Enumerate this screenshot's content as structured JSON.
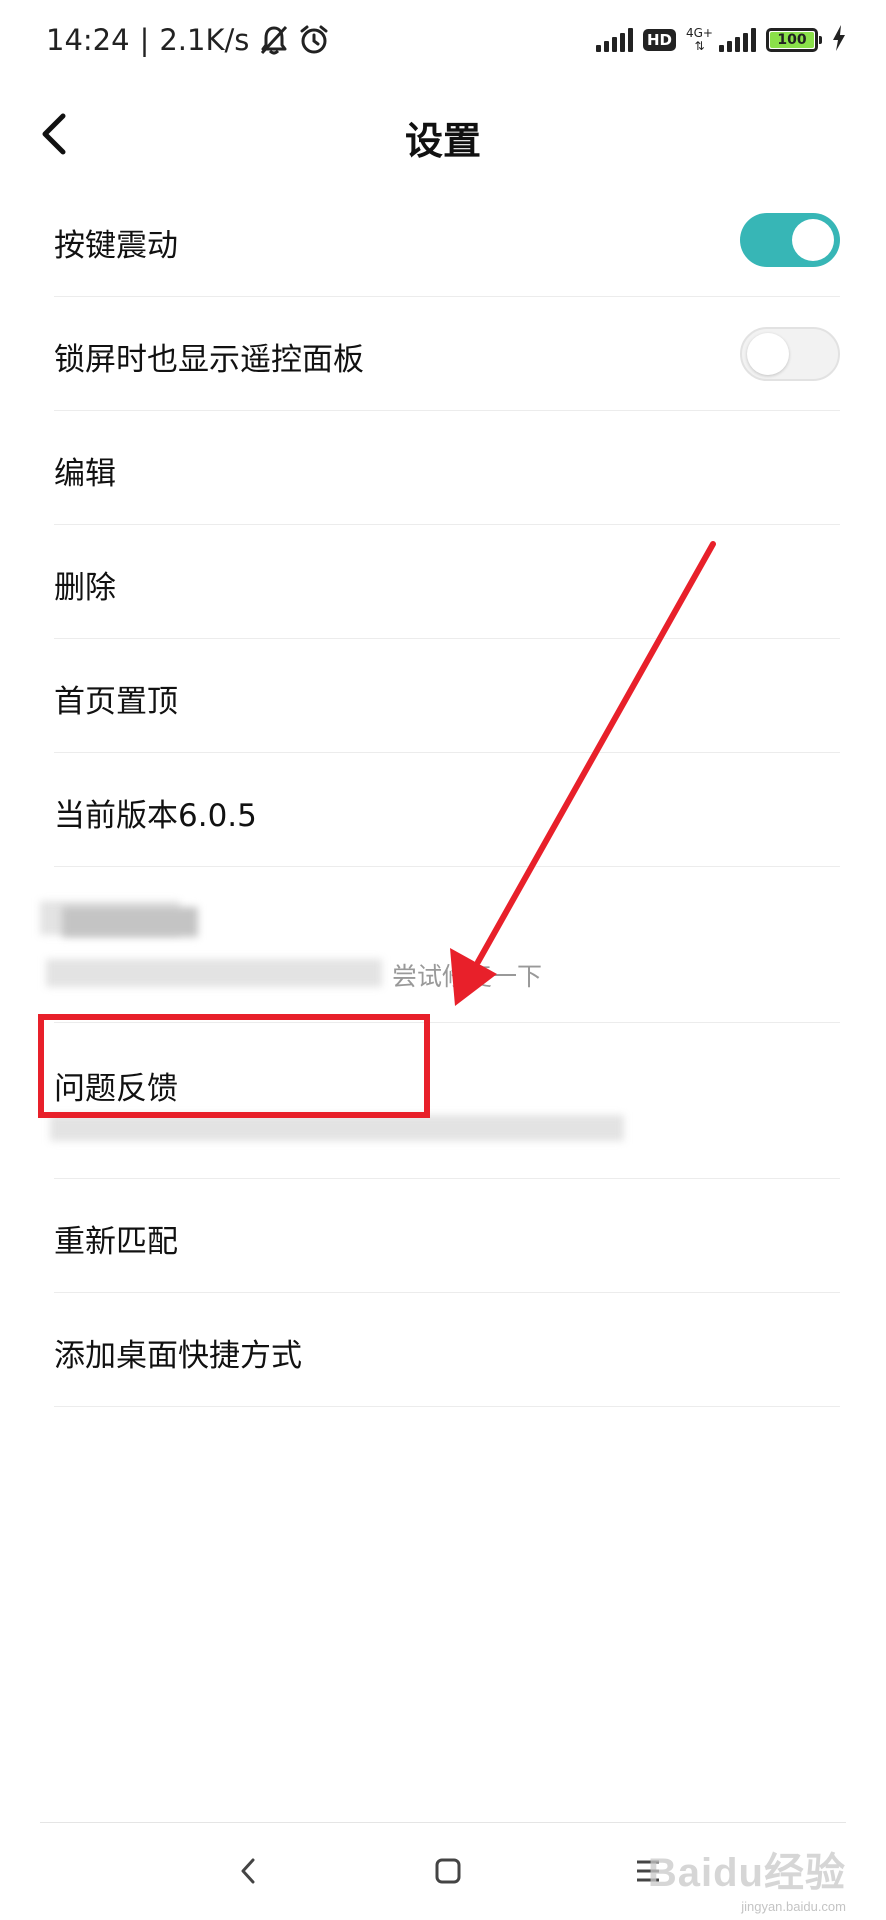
{
  "status_bar": {
    "time": "14:24",
    "separator": "|",
    "net_speed": "2.1K/s",
    "hd_label": "HD",
    "network_type": "4G+",
    "battery_level": "100",
    "icons": [
      "bell-off-icon",
      "alarm-icon",
      "signal-icon",
      "hd-icon",
      "signal-4g-icon",
      "battery-icon",
      "charging-icon"
    ]
  },
  "header": {
    "title": "设置",
    "back_icon": "chevron-left-icon"
  },
  "settings": {
    "key_vibration": {
      "label": "按键震动",
      "enabled": true
    },
    "lock_screen_panel": {
      "label": "锁屏时也显示遥控面板",
      "enabled": false
    },
    "edit": {
      "label": "编辑"
    },
    "delete": {
      "label": "删除"
    },
    "pin_top": {
      "label": "首页置顶"
    },
    "version": {
      "label": "当前版本6.0.5"
    },
    "repair": {
      "sub_visible": "尝试修复一下"
    },
    "feedback": {
      "label": "问题反馈"
    },
    "rematch": {
      "label": "重新匹配"
    },
    "add_shortcut": {
      "label": "添加桌面快捷方式"
    }
  },
  "colors": {
    "toggle_on": "#37b6b6",
    "annotation_red": "#e8202a"
  },
  "nav_bar": {
    "icons": [
      "back-icon",
      "home-icon",
      "menu-icon"
    ]
  },
  "watermark": {
    "text": "Baidu经验",
    "sub": "jingyan.baidu.com"
  }
}
